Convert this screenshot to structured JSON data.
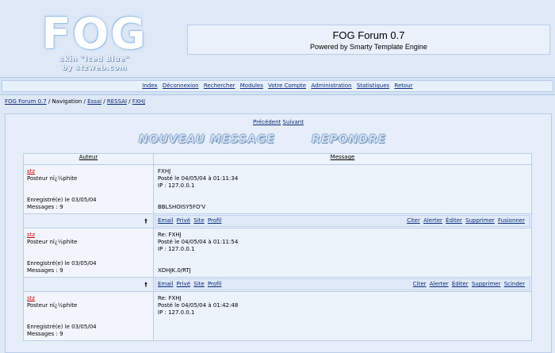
{
  "header": {
    "logo_text": "FOG",
    "logo_sub1": "skin \"Iced Blue\"",
    "logo_sub2": "by stzweb.com",
    "title": "FOG Forum 0.7",
    "subtitle": "Powered by Smarty Template Engine"
  },
  "menu": {
    "items": [
      "Index",
      "Déconnexion",
      "Rechercher",
      "Modules",
      "Votre Compte",
      "Administration",
      "Statistiques",
      "Retour"
    ]
  },
  "breadcrumb": {
    "root": "FOG Forum 0.7",
    "sep1": " / Navigation / ",
    "c1": "Essai",
    "c2": "RESSAI",
    "c3": "FXHJ",
    "sep": " / "
  },
  "pager": {
    "prev": "Précédent",
    "next": "Suivant"
  },
  "buttons": {
    "new_message": "NOUVEAU MESSAGE",
    "reply": "REPONDRE"
  },
  "table": {
    "col_author": "Auteur",
    "col_message": "Message"
  },
  "posts": [
    {
      "author": "stz",
      "rank": "Posteur nï¿½phite",
      "registered": "Enregistré(e) le 03/05/04",
      "count": "Messages : 9",
      "subject": "FXHJ",
      "posted": "Posté le 04/05/04 à 01:11:34",
      "ip": "IP : 127.0.0.1",
      "body": "BBLSHOISY5FO'V",
      "left_actions": [
        "Email",
        "Privé",
        "Site",
        "Profil"
      ],
      "right_actions": [
        "Citer",
        "Alerter",
        "Éditer",
        "Supprimer",
        "Fusionner"
      ]
    },
    {
      "author": "stz",
      "rank": "Posteur nï¿½phite",
      "registered": "Enregistré(e) le 03/05/04",
      "count": "Messages : 9",
      "subject": "Re: FXHJ",
      "posted": "Posté le 04/05/04 à 01:11:54",
      "ip": "IP : 127.0.0.1",
      "body": "XDHJK.0/RTJ",
      "left_actions": [
        "Email",
        "Privé",
        "Site",
        "Profil"
      ],
      "right_actions": [
        "Citer",
        "Alerter",
        "Éditer",
        "Supprimer",
        "Scinder"
      ]
    },
    {
      "author": "stz",
      "rank": "Posteur nï¿½phite",
      "registered": "Enregistré(e) le 03/05/04",
      "count": "Messages : 9",
      "subject": "Re: FXHJ",
      "posted": "Posté le 04/05/04 à 01:42:48",
      "ip": "IP : 127.0.0.1"
    }
  ],
  "colors": {
    "background": "#dfe8f6",
    "link": "#0b2a7a",
    "author": "#c00000",
    "border": "#b9cde8"
  }
}
